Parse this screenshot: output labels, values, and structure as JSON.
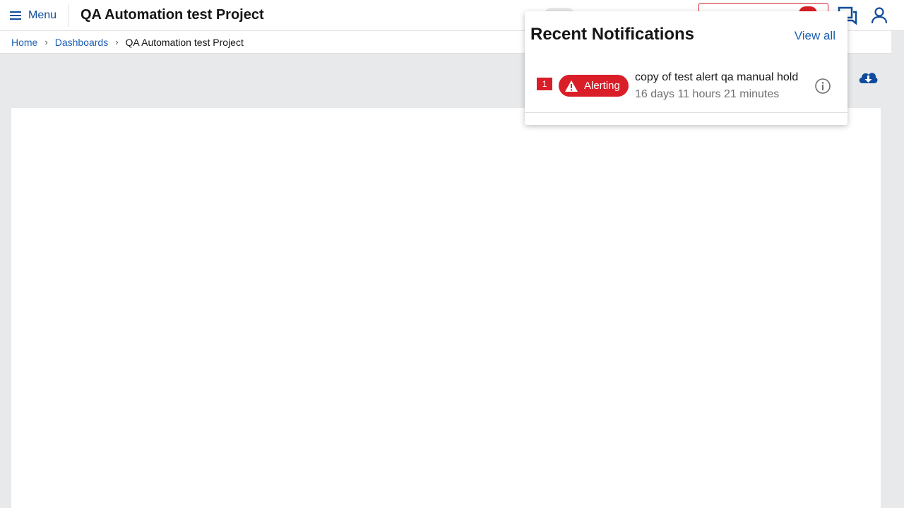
{
  "header": {
    "menu_label": "Menu",
    "project_title": "QA Automation test Project"
  },
  "breadcrumb": {
    "home": "Home",
    "dashboards": "Dashboards",
    "current": "QA Automation test Project",
    "separator": "›"
  },
  "notifications": {
    "title": "Recent Notifications",
    "view_all": "View all",
    "items": [
      {
        "count": "1",
        "status": "Alerting",
        "text": "copy of test alert qa manual hold",
        "time": "16 days 11 hours 21 minutes"
      }
    ]
  },
  "colors": {
    "accent": "#0f62fe",
    "alert": "#da1e28",
    "link": "#1c5fb0"
  },
  "icons": {
    "menu": "hamburger-icon",
    "chat": "chat-icon",
    "user": "user-icon",
    "download": "cloud-download-icon",
    "warning": "warning-triangle-icon",
    "info": "info-icon"
  }
}
